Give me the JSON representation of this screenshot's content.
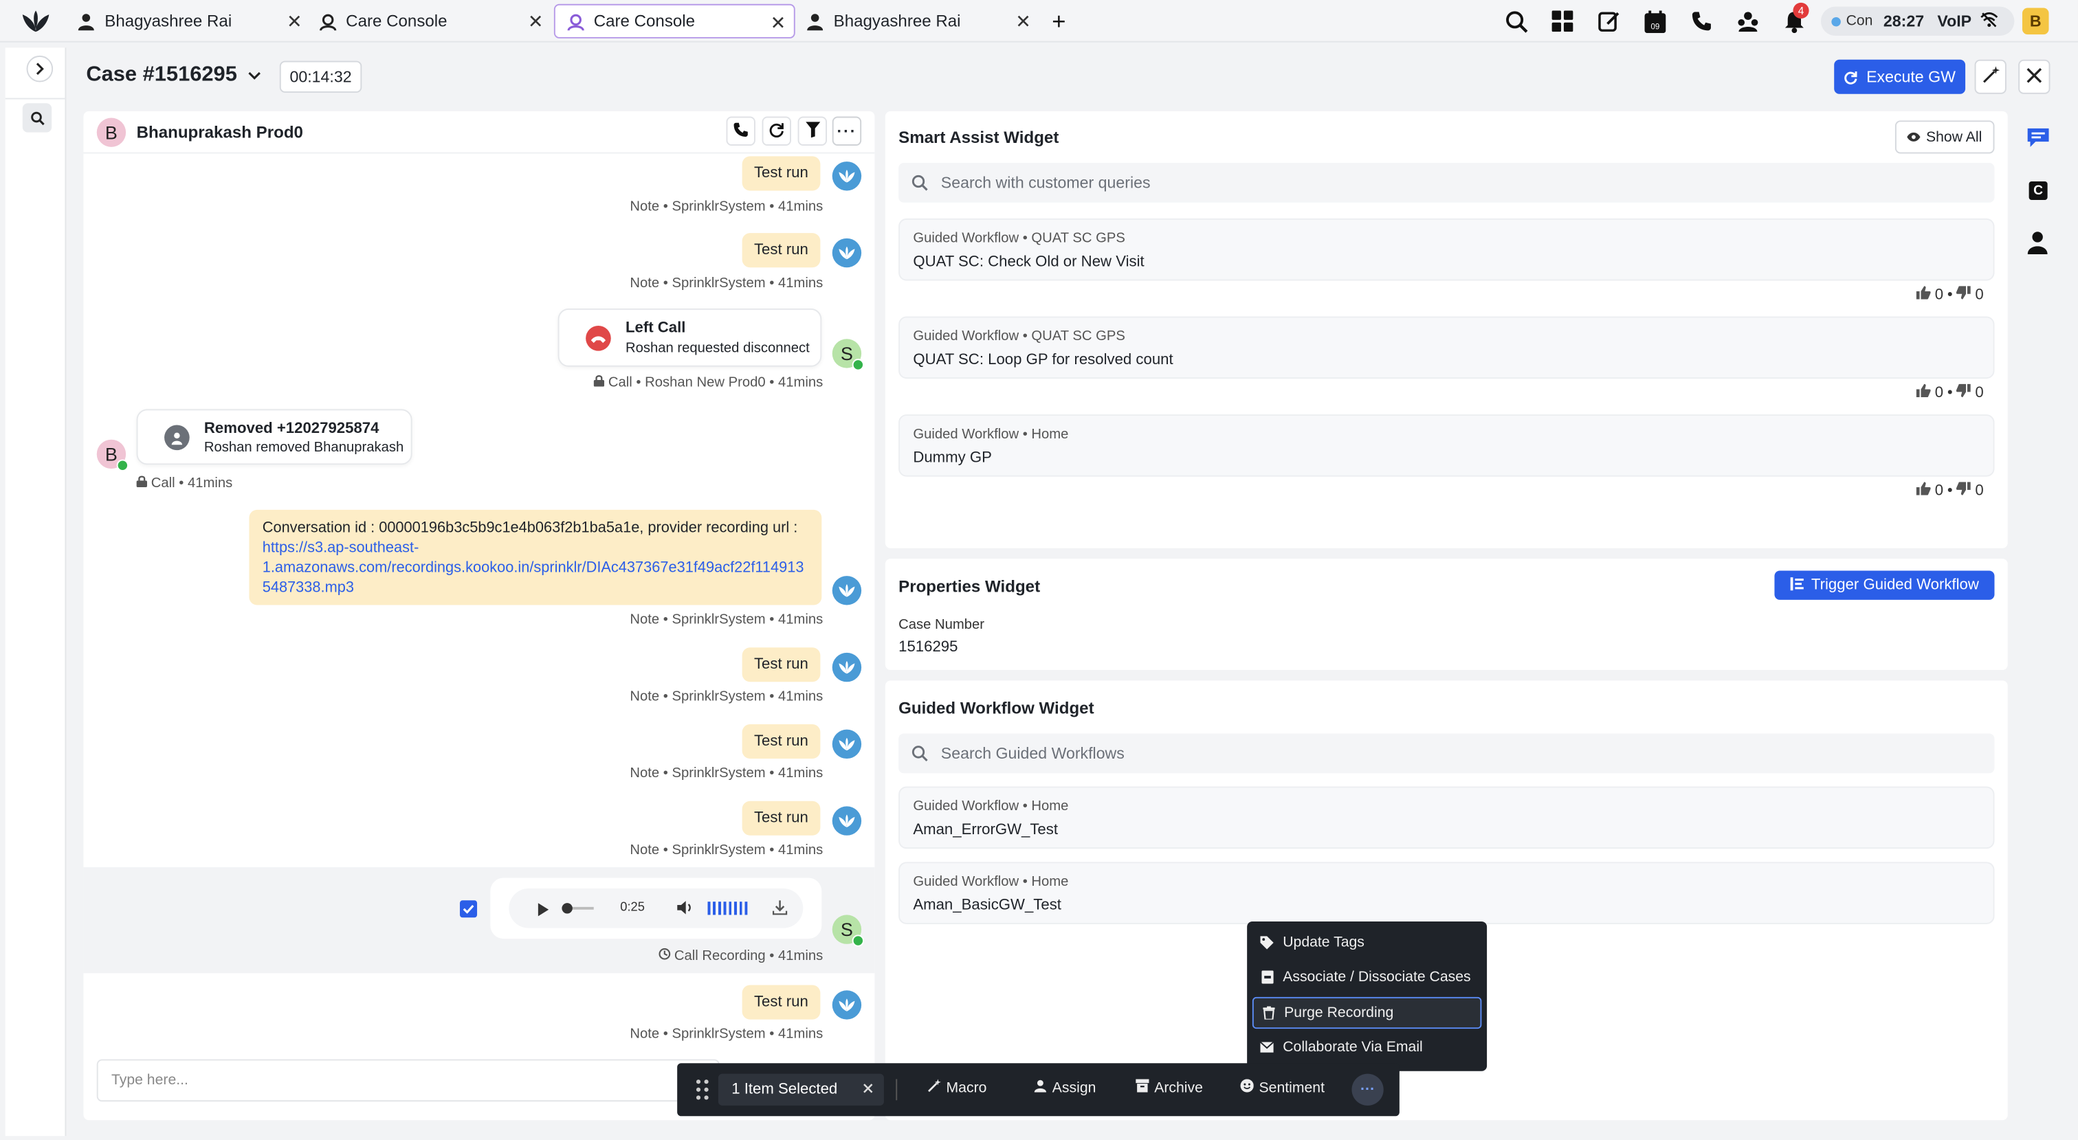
{
  "tabs": [
    {
      "label": "Bhagyashree Rai",
      "icon": "user-icon"
    },
    {
      "label": "Care Console",
      "icon": "care-console-icon"
    },
    {
      "label": "Care Console",
      "icon": "care-console-icon",
      "active": true
    },
    {
      "label": "Bhagyashree Rai",
      "icon": "user-icon"
    }
  ],
  "topbar": {
    "status_label": "Con",
    "status_timer": "28:27",
    "voip_label": "VoIP",
    "notification_count": "4",
    "avatar_letter": "B",
    "calendar_day": "09"
  },
  "case": {
    "title": "Case #1516295",
    "timer": "00:14:32",
    "execute_label": "Execute GW"
  },
  "conversation": {
    "contact_name": "Bhanuprakash Prod0",
    "contact_initial": "B",
    "messages": {
      "m1_text": "Test run",
      "m1_meta": "Note • SprinklrSystem • 41mins",
      "m2_text": "Test run",
      "m2_meta": "Note • SprinklrSystem • 41mins",
      "call_title": "Left Call",
      "call_sub": "Roshan requested disconnect",
      "call_meta": "Call • Roshan New Prod0 • 41mins",
      "s_initial": "S",
      "removed_title": "Removed +12027925874",
      "removed_sub": "Roshan removed Bhanuprakash",
      "removed_meta": "Call • 41mins",
      "b_initial": "B",
      "conv_text_1": "Conversation id : 00000196b3c5b9c1e4b063f2b1ba5a1e, provider recording url :",
      "conv_link_1": "https://s3.ap-southeast-",
      "conv_link_2": "1.amazonaws.com/recordings.kookoo.in/sprinklr/DIAc437367e31f49acf22f114913",
      "conv_link_3": "5487338.mp3",
      "conv_meta": "Note • SprinklrSystem • 41mins",
      "m3_text": "Test run",
      "m3_meta": "Note • SprinklrSystem • 41mins",
      "m4_text": "Test run",
      "m4_meta": "Note • SprinklrSystem • 41mins",
      "m5_text": "Test run",
      "m5_meta": "Note • SprinklrSystem • 41mins",
      "audio_time": "0:25",
      "audio_progress": 0.0,
      "recording_meta": "Call Recording • 41mins",
      "m6_text": "Test run",
      "m6_meta": "Note • SprinklrSystem • 41mins"
    },
    "input_placeholder": "Type here..."
  },
  "smart_assist": {
    "title": "Smart Assist Widget",
    "show_all": "Show All",
    "search_placeholder": "Search with customer queries",
    "items": [
      {
        "sub": "Guided Workflow • QUAT SC GPS",
        "name": "QUAT SC: Check Old or New Visit",
        "up": "0",
        "down": "0"
      },
      {
        "sub": "Guided Workflow • QUAT SC GPS",
        "name": "QUAT SC: Loop GP for resolved count",
        "up": "0",
        "down": "0"
      },
      {
        "sub": "Guided Workflow • Home",
        "name": "Dummy GP",
        "up": "0",
        "down": "0"
      }
    ]
  },
  "properties": {
    "title": "Properties Widget",
    "trigger_label": "Trigger Guided Workflow",
    "field_label": "Case Number",
    "field_value": "1516295"
  },
  "guided_workflow": {
    "title": "Guided Workflow Widget",
    "search_placeholder": "Search Guided Workflows",
    "items": [
      {
        "sub": "Guided Workflow • Home",
        "name": "Aman_ErrorGW_Test"
      },
      {
        "sub": "Guided Workflow • Home",
        "name": "Aman_BasicGW_Test"
      }
    ]
  },
  "context_menu": {
    "items": [
      {
        "label": "Update Tags",
        "icon": "tag-icon"
      },
      {
        "label": "Associate / Dissociate Cases",
        "icon": "case-icon"
      },
      {
        "label": "Purge Recording",
        "icon": "trash-icon",
        "selected": true
      },
      {
        "label": "Collaborate Via Email",
        "icon": "mail-icon"
      }
    ]
  },
  "bulk_bar": {
    "selected_label": "1 Item Selected",
    "macro": "Macro",
    "assign": "Assign",
    "archive": "Archive",
    "sentiment": "Sentiment"
  },
  "colors": {
    "primary": "#2b5ee8",
    "note_bubble": "#fdedc7",
    "dark_menu": "#1f2329",
    "accent_purple": "#b79be8"
  }
}
